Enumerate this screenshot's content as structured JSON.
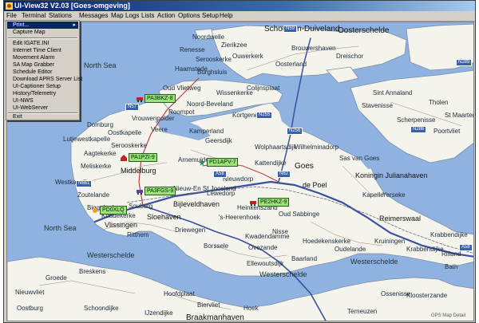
{
  "window": {
    "title": "UI-View32 V2.03 [Goes-omgeving]"
  },
  "menu": [
    "File",
    "Terminal",
    "Stations",
    "Messages",
    "Map",
    "Logs",
    "Lists",
    "Action",
    "Options",
    "Setup",
    "Help"
  ],
  "file_menu": {
    "items": [
      {
        "label": "Print...",
        "highlight": true,
        "submenu": true
      },
      {
        "label": "Capture Map"
      },
      {
        "separator": true
      },
      {
        "label": "Edit IGATE.INI"
      },
      {
        "label": "Internet Time Client"
      },
      {
        "label": "Movement Alarm"
      },
      {
        "label": "SA Map Grabber"
      },
      {
        "label": "Schedule Editor"
      },
      {
        "label": "Download APRS Server List"
      },
      {
        "label": "UI-Captioner Setup"
      },
      {
        "label": "History/Telemetry"
      },
      {
        "label": "UI-NWS"
      },
      {
        "label": "UI-WebServer"
      },
      {
        "separator": true
      },
      {
        "label": "Exit"
      }
    ]
  },
  "map": {
    "places": {
      "schouwen": "Schouwen-Duiveland",
      "north_sea_1": "North Sea",
      "north_sea_2": "North Sea",
      "westerschelde_1": "Westerschelde",
      "westerschelde_2": "Westerschelde",
      "westerschelde_3": "Westerschelde",
      "oosterschelde": "Oosterschelde",
      "middelburg": "Middelburg",
      "goes": "Goes",
      "vlissingen": "Vlissingen",
      "koningin": "Koningin Julianahaven",
      "reimerswaal": "Reimerswaal",
      "braakman": "Braakmanhaven",
      "bijleveldhaven": "Bijleveldhaven",
      "sloehaven": "Sloehaven",
      "nieuw_st_joosland": "Nieuw-En St Joosland",
      "heerenhoek": "'s-Heerenhoek",
      "wilhelminadorp": "Wilhelminadorp",
      "veere": "Veere",
      "domburg": "Domburg",
      "serooskerke": "Serooskerke",
      "aagtekerke": "Aagtekerke",
      "meliskerke": "Meliskerke",
      "kapelle": "Kapelle",
      "wolphaartsdijk": "Wolphaartsdijk",
      "kortgene": "Kortgene",
      "noord_beveland": "Noord-Beveland",
      "wissenkerke": "Wissenkerke",
      "colijnsplaat": "Colijnsplaat",
      "oud_vlietweg": "Oud Vlietweg",
      "tholen": "Tholen",
      "poortvliet": "Poortvliet",
      "borssele": "Borssele",
      "ovezande": "Ovezande",
      "baarland": "Baarland",
      "yerseke": "Yerseke",
      "kruiningen": "Kruiningen",
      "ellewoutsdijk": "Ellewoutsdijk",
      "hoedekenskerke": "Hoedekenskerke",
      "kwadendamme": "Kwadendamme",
      "nisse": "Nisse",
      "hoek": "Hoek",
      "schoondijke": "Schoondijke",
      "breskens": "Breskens",
      "groede": "Groede",
      "hoofdplaat": "Hoofdplaat",
      "biervliet": "Biervliet",
      "oostburg": "Oostburg",
      "nieuwvliet": "Nieuwvliet",
      "ijzendijke": "IJzendijke",
      "terneuzen": "Terneuzen",
      "kloosterzande": "Kloosterzande",
      "oudelande": "Oudelande",
      "driewegen": "Driewegen",
      "krabbendijke": "Krabbendijke",
      "ossenisse": "Ossenisse",
      "zierikzee": "Zierikzee",
      "dreischor": "Dreischor",
      "noordwelle": "Noordwelle",
      "ouwerkerk": "Ouwerkerk",
      "oosterland": "Oosterland",
      "sint_annaland": "Sint Annaland",
      "stavenisse": "Stavenisse",
      "scherpenisse": "Scherpenisse",
      "st_maartensdijk": "St Maartensdijk",
      "oud_sabbinge": "Oud Sabbinge",
      "sas_van_goes": "Sas van Goes",
      "de_poel": "de Poel",
      "ritthem": "Ritthem",
      "souburg": "Souburg",
      "arnemuiden": "Arnemuiden",
      "lewedorp": "Lewedorp",
      "heinkenszand": "Heinkenszand",
      "nieuwdorp": "Nieuwdorp",
      "kattendijke": "Kattendijke",
      "lutjewestkapelle": "Lutjewestkapelle",
      "westkapelle": "Westkapelle",
      "zoutelande": "Zoutelande",
      "biggekerke": "Biggekerke",
      "koudekerke": "Koudekerke",
      "oostkapelle": "Oostkapelle",
      "vrouwenpolder": "Vrouwenpolder",
      "kamperland": "Kamperland",
      "geersdijk": "Geersdijk",
      "roompot": "Roompot",
      "burghsluis": "Burghsluis",
      "renesse": "Renesse",
      "serooskerke_s": "Serooskerke",
      "haamstede": "Haamstede",
      "brouwershaven": "Brouwershaven",
      "krabbendijke_h": "Krabbendijke",
      "bath": "Bath",
      "rilland": "Rilland"
    },
    "roads": [
      "N59",
      "N255",
      "N256",
      "N57",
      "A58",
      "N62",
      "N661",
      "N286",
      "A58",
      "N289"
    ],
    "stations": [
      "PA3BKZ-8",
      "PA1PZI-9",
      "PD1APV-7",
      "PA3FGS-9",
      "PD0XLQ",
      "PE2HKZ-9"
    ],
    "status": "GPS Map Detail"
  }
}
